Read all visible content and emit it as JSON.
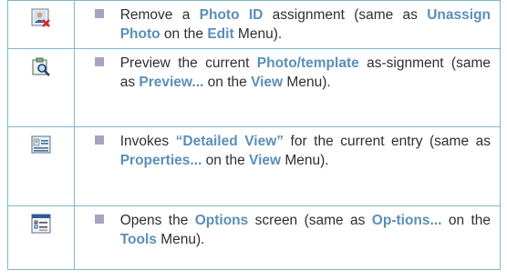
{
  "rows": [
    {
      "icon": "remove-photo-id-icon",
      "text": {
        "a": "Remove a ",
        "b": "Photo ID",
        "c": " assignment (same as ",
        "d": "Unassign Photo",
        "e": " on the ",
        "f": "Edit",
        "g": " Menu)."
      }
    },
    {
      "icon": "preview-photo-icon",
      "text": {
        "a": "Preview the current ",
        "b": "Photo/template",
        "c": " as-signment (same as ",
        "d": "Preview...",
        "e": " on the ",
        "f": "View",
        "g": " Menu)."
      }
    },
    {
      "icon": "detailed-view-icon",
      "text": {
        "a": "Invokes ",
        "b": "“Detailed View”",
        "c": " for the current entry (same as ",
        "d": "Properties...",
        "e": " on the ",
        "f": "View",
        "g": " Menu)."
      }
    },
    {
      "icon": "options-icon",
      "text": {
        "a": "Opens the ",
        "b": "Options",
        "c": " screen (same as ",
        "d": "Op-tions...",
        "e": " on the ",
        "f": "Tools",
        "g": " Menu)."
      }
    }
  ],
  "colors": {
    "border": "#7fb8c9",
    "highlight": "#5a8fb8",
    "bullet": "#a9a3c2",
    "text": "#2f2f2f"
  }
}
